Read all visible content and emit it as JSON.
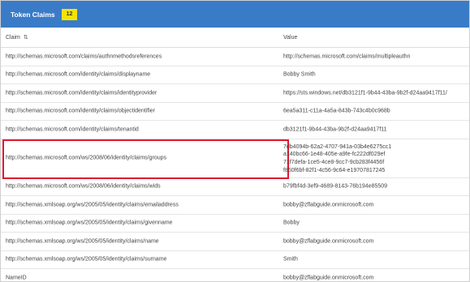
{
  "header": {
    "title": "Token Claims",
    "count": "12"
  },
  "columns": {
    "claim": "Claim",
    "value": "Value"
  },
  "rows": [
    {
      "claim": "http://schemas.microsoft.com/claims/authnmethodsreferences",
      "value": "http://schemas.microsoft.com/claims/multipleauthn"
    },
    {
      "claim": "http://schemas.microsoft.com/identity/claims/displayname",
      "value": "Bobby Smith"
    },
    {
      "claim": "http://schemas.microsoft.com/identity/claims/identityprovider",
      "value": "https://sts.windows.net/db3121f1-9b44-43ba-9b2f-d24aa9417f11/"
    },
    {
      "claim": "http://schemas.microsoft.com/identity/claims/objectidentifier",
      "value": "6ea5a311-c11a-4a5a-843b-743c4b0c968b"
    },
    {
      "claim": "http://schemas.microsoft.com/identity/claims/tenantid",
      "value": "db3121f1-9b44-43ba-9b2f-d24aa9417f11"
    },
    {
      "claim": "http://schemas.microsoft.com/ws/2008/06/identity/claims/groups",
      "value_lines": [
        "7db4094b-62a2-4707-941a-03b4e6275cc1",
        "a140bc66-1e48-405e-a9fe-fc222df029ef",
        "71f7defa-1ce5-4ce8-9cc7-9cb283f4456f",
        "f850f6bf-82f1-4c56-9c64-e19707817245"
      ]
    },
    {
      "claim": "http://schemas.microsoft.com/ws/2008/06/identity/claims/wids",
      "value": "b79fbf4d-3ef9-4689-8143-76b194e85509"
    },
    {
      "claim": "http://schemas.xmlsoap.org/ws/2005/05/identity/claims/emailaddress",
      "value": "bobby@zflabguide.onmicrosoft.com"
    },
    {
      "claim": "http://schemas.xmlsoap.org/ws/2005/05/identity/claims/givenname",
      "value": "Bobby"
    },
    {
      "claim": "http://schemas.xmlsoap.org/ws/2005/05/identity/claims/name",
      "value": "bobby@zflabguide.onmicrosoft.com"
    },
    {
      "claim": "http://schemas.xmlsoap.org/ws/2005/05/identity/claims/surname",
      "value": "Smith"
    },
    {
      "claim": "NameID",
      "value": "bobby@zflabguide.onmicrosoft.com"
    }
  ],
  "icons": {
    "sort": "sort-arrows-icon"
  },
  "colors": {
    "titlebar": "#3a7bc8",
    "badge": "#f5e300",
    "highlight": "#e0182d"
  }
}
